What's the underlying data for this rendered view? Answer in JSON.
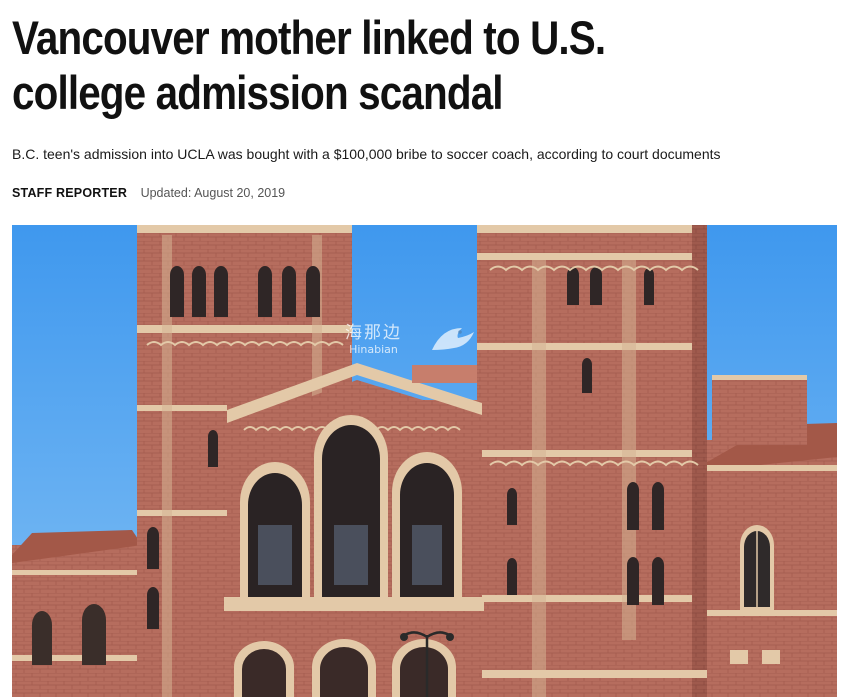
{
  "article": {
    "headline": "Vancouver mother linked to U.S. college admission scandal",
    "subheadline": "B.C. teen's admission into UCLA was bought with a $100,000 bribe to soccer coach, according to court documents",
    "author": "STAFF REPORTER",
    "updated": "Updated: August 20, 2019"
  },
  "photo": {
    "subject": "brick building with twin towers and arched entrance",
    "watermark_logo": "海那边",
    "watermark_text": "Hinabian",
    "colors": {
      "sky": "#5aaaf0",
      "brick": "#b36a5c",
      "stone": "#e3c9a8"
    }
  }
}
